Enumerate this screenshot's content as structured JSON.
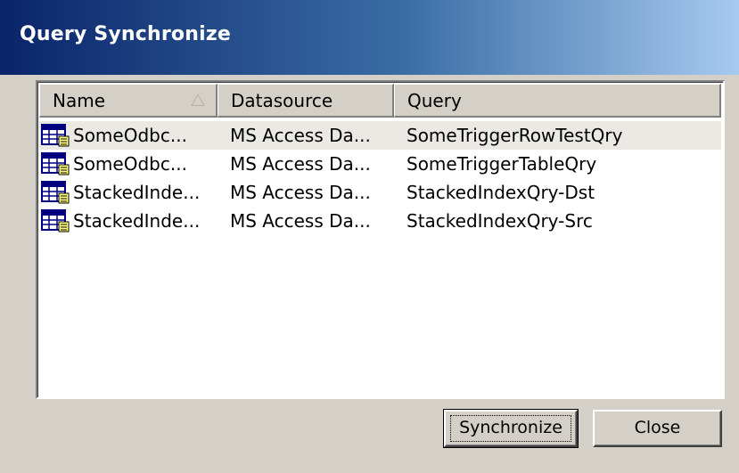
{
  "window": {
    "title": "Query Synchronize"
  },
  "list": {
    "columns": [
      {
        "label": "Name",
        "sorted": "ascending"
      },
      {
        "label": "Datasource"
      },
      {
        "label": "Query"
      }
    ],
    "rows": [
      {
        "name": "SomeOdbc...",
        "datasource": "MS Access Da...",
        "query": "SomeTriggerRowTestQry",
        "selected": true,
        "icon": "query-table-icon"
      },
      {
        "name": "SomeOdbc...",
        "datasource": "MS Access Da...",
        "query": "SomeTriggerTableQry",
        "selected": false,
        "icon": "query-table-icon"
      },
      {
        "name": "StackedInde...",
        "datasource": "MS Access Da...",
        "query": "StackedIndexQry-Dst",
        "selected": false,
        "icon": "query-table-icon"
      },
      {
        "name": "StackedInde...",
        "datasource": "MS Access Da...",
        "query": "StackedIndexQry-Src",
        "selected": false,
        "icon": "query-table-icon"
      }
    ]
  },
  "buttons": {
    "synchronize": "Synchronize",
    "close": "Close"
  },
  "colors": {
    "titlebar_start": "#0a246a",
    "titlebar_end": "#a6caf0",
    "dialog_face": "#d4d0c8",
    "selected_row": "#ebe9e4"
  }
}
